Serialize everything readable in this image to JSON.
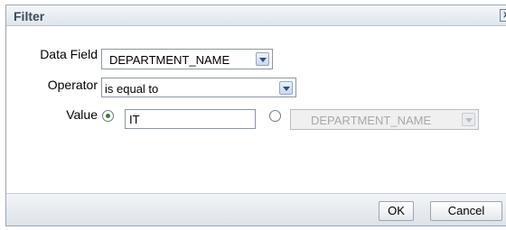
{
  "dialog": {
    "title": "Filter",
    "close_symbol": "x"
  },
  "data_field": {
    "label": "Data Field",
    "value": "DEPARTMENT_NAME"
  },
  "operator": {
    "label": "Operator",
    "value": "is equal to"
  },
  "value_row": {
    "label": "Value",
    "text_option_selected": true,
    "text_value": "IT",
    "field_option_selected": false,
    "field_value": "DEPARTMENT_NAME"
  },
  "buttons": {
    "ok": "OK",
    "cancel": "Cancel"
  }
}
